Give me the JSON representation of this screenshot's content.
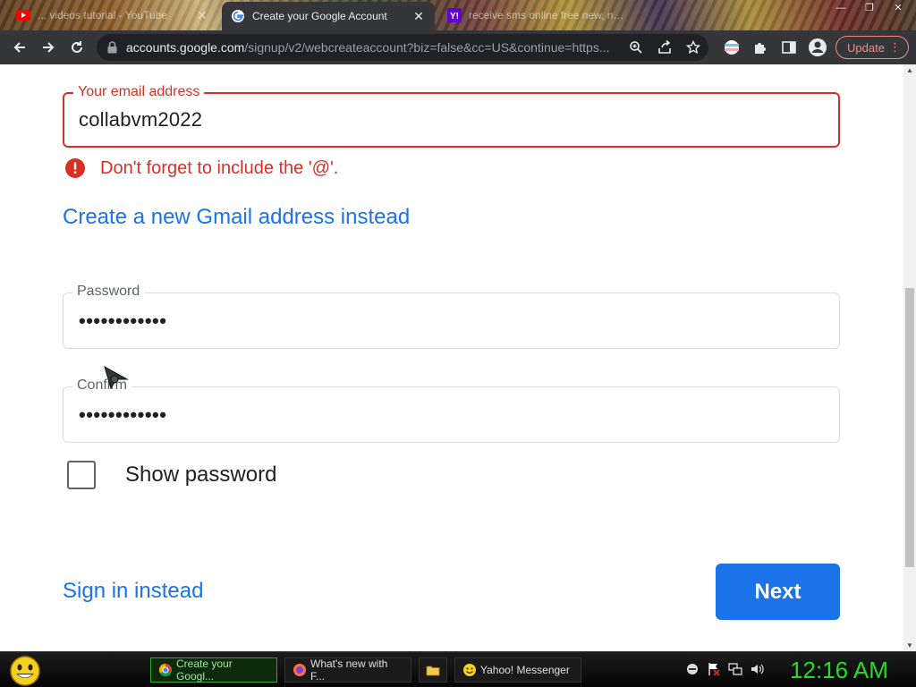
{
  "browser": {
    "tabs": [
      {
        "title": "... videos tutorial - YouTube",
        "icon": "youtube-icon",
        "active": false
      },
      {
        "title": "Create your Google Account",
        "icon": "google-icon",
        "active": true
      },
      {
        "title": "receive sms online free new, num",
        "icon": "yahoo-icon",
        "active": false
      }
    ],
    "url_host": "accounts.google.com",
    "url_rest": "/signup/v2/webcreateaccount?biz=false&cc=US&continue=https...",
    "update_label": "Update"
  },
  "form": {
    "email": {
      "label": "Your email address",
      "value": "collabvm2022"
    },
    "error_text": "Don't forget to include the '@'.",
    "create_gmail_link": "Create a new Gmail address instead",
    "password": {
      "label": "Password",
      "value": "••••••••••••"
    },
    "confirm": {
      "label": "Confirm",
      "value": "••••••••••••"
    },
    "show_password_label": "Show password",
    "sign_in_link": "Sign in instead",
    "next_label": "Next"
  },
  "taskbar": {
    "items": [
      {
        "label": "Create your Googl...",
        "icon": "chrome-icon",
        "active": true
      },
      {
        "label": "What's new with F...",
        "icon": "firefox-icon",
        "active": false
      },
      {
        "label": "",
        "icon": "folder-icon",
        "active": false
      },
      {
        "label": "Yahoo! Messenger",
        "icon": "messenger-icon",
        "active": false
      }
    ],
    "clock": "12:16 AM"
  },
  "colors": {
    "error": "#d93025",
    "link": "#1a73e8",
    "primary_button": "#1a73e8",
    "clock": "#22dd22"
  }
}
